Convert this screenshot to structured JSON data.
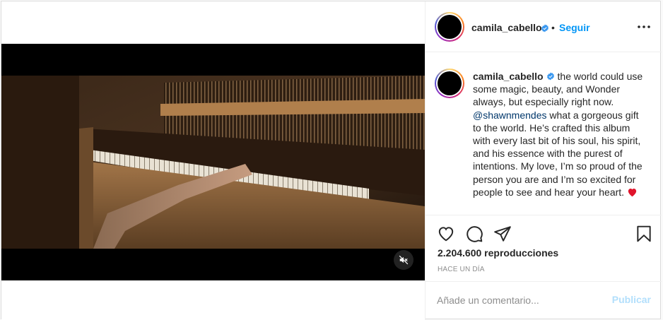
{
  "post": {
    "username": "camila_cabello",
    "follow_separator": "•",
    "follow_label": "Seguir",
    "more_icon": "more-options-icon",
    "caption_username": "camila_cabello",
    "caption_part1": "the world could use some magic, beauty, and Wonder always, but especially right now.",
    "caption_mention": "@shawnmendes",
    "caption_part2": "what a gorgeous gift to the world. He’s crafted this album with every last bit of his soul, his spirit, and his essence with the purest of intentions. My love, I’m so proud of the person you are and I’m so excited for people to see and hear your heart.",
    "caption_emoji": "red-heart-emoji",
    "views": "2.204.600 reproducciones",
    "timestamp": "HACE UN DÍA",
    "comment_placeholder": "Añade un comentario...",
    "publish_label": "Publicar"
  },
  "icons": {
    "like": "heart-icon",
    "comment": "comment-icon",
    "share": "share-icon",
    "save": "bookmark-icon",
    "mute": "muted-speaker-icon",
    "verified": "verified-badge-icon"
  },
  "colors": {
    "follow_blue": "#0095f6",
    "publish_disabled": "#b2dffc",
    "mention": "#00376b",
    "border": "#dbdbdb"
  }
}
